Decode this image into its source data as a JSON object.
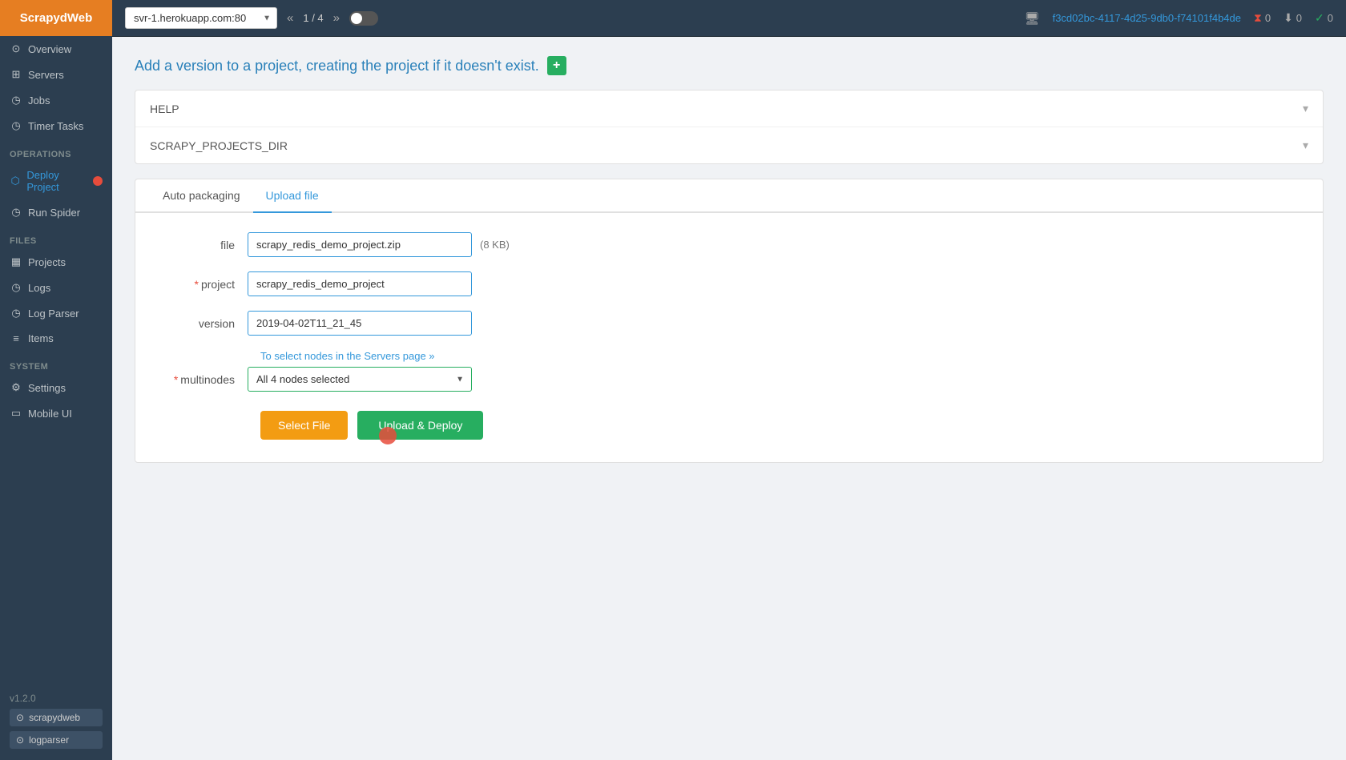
{
  "sidebar": {
    "logo": "ScrapydWeb",
    "sections": [
      {
        "title": "",
        "items": [
          {
            "id": "overview",
            "label": "Overview",
            "icon": "⊙",
            "active": false
          }
        ]
      },
      {
        "title": "",
        "items": [
          {
            "id": "servers",
            "label": "Servers",
            "icon": "⊞",
            "active": false
          },
          {
            "id": "jobs",
            "label": "Jobs",
            "icon": "◷",
            "active": false
          },
          {
            "id": "timer-tasks",
            "label": "Timer Tasks",
            "icon": "◷",
            "active": false
          }
        ]
      },
      {
        "title": "Operations",
        "items": [
          {
            "id": "deploy-project",
            "label": "Deploy Project",
            "icon": "⬡",
            "active": true,
            "dot": true
          },
          {
            "id": "run-spider",
            "label": "Run Spider",
            "icon": "◷",
            "active": false
          }
        ]
      },
      {
        "title": "Files",
        "items": [
          {
            "id": "projects",
            "label": "Projects",
            "icon": "▦",
            "active": false
          },
          {
            "id": "logs",
            "label": "Logs",
            "icon": "◷",
            "active": false
          },
          {
            "id": "log-parser",
            "label": "Log Parser",
            "icon": "◷",
            "active": false
          },
          {
            "id": "items",
            "label": "Items",
            "icon": "≡",
            "active": false
          }
        ]
      },
      {
        "title": "System",
        "items": [
          {
            "id": "settings",
            "label": "Settings",
            "icon": "⚙",
            "active": false
          },
          {
            "id": "mobile-ui",
            "label": "Mobile UI",
            "icon": "▭",
            "active": false
          }
        ]
      }
    ],
    "version": "v1.2.0",
    "github_btns": [
      "scrapydweb",
      "logparser"
    ]
  },
  "topbar": {
    "server": "svr-1.herokuapp.com:80",
    "page_current": "1",
    "page_total": "4",
    "link_text": "f3cd02bc-4117-4d25-9db0-f74101f4b4de",
    "stat1_icon": "⧗",
    "stat1_value": "0",
    "stat2_icon": "⬇",
    "stat2_value": "0",
    "stat3_icon": "✓",
    "stat3_value": "0"
  },
  "page": {
    "heading": "Add a version to a project, creating the project if it doesn't exist.",
    "plus_btn": "+",
    "collapsibles": [
      {
        "label": "HELP"
      },
      {
        "label": "SCRAPY_PROJECTS_DIR"
      }
    ],
    "tabs": [
      {
        "label": "Auto packaging",
        "active": false
      },
      {
        "label": "Upload file",
        "active": true
      }
    ],
    "form": {
      "file_label": "file",
      "file_value": "scrapy_redis_demo_project.zip",
      "file_size": "(8 KB)",
      "project_label": "project",
      "project_required": "*",
      "project_value": "scrapy_redis_demo_project",
      "version_label": "version",
      "version_value": "2019-04-02T11_21_45",
      "multinodes_label": "multinodes",
      "multinodes_required": "*",
      "multinodes_link": "To select nodes in the Servers page »",
      "multinodes_value": "All 4 nodes selected",
      "btn_select_file": "Select File",
      "btn_upload_deploy": "Upload & Deploy"
    }
  }
}
